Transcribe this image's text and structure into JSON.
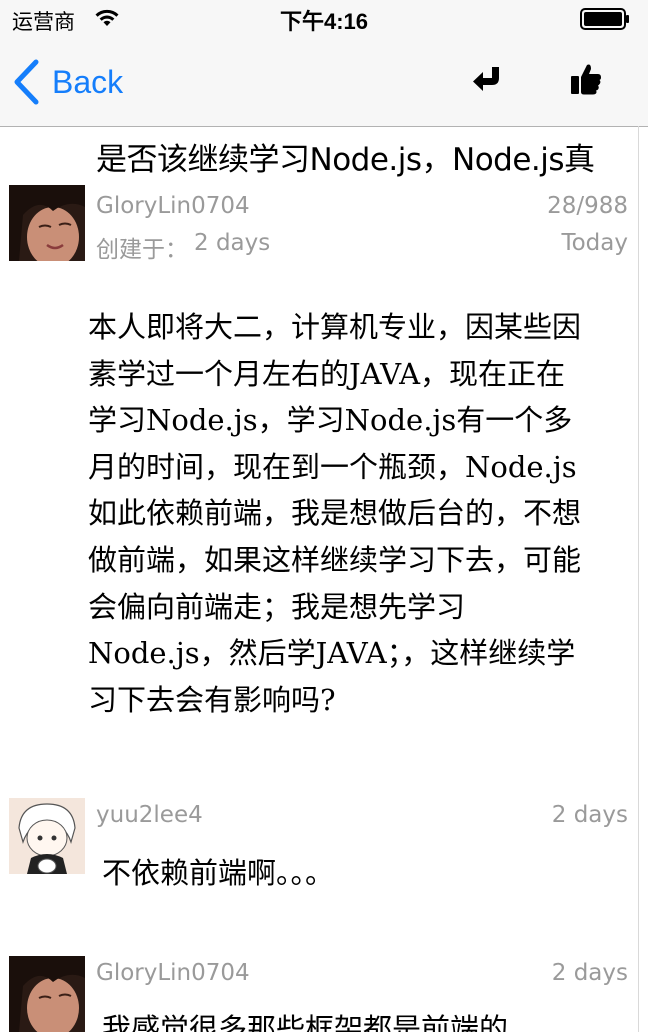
{
  "status_bar": {
    "carrier": "运营商",
    "time": "下午4:16"
  },
  "nav": {
    "back_label": "Back",
    "actions": [
      "reply-icon",
      "thumbs-up-icon"
    ]
  },
  "topic": {
    "title": "是否该继续学习Node.js，Node.js真",
    "author": "GloryLin0704",
    "counts": "28/988",
    "created_label": "创建于：",
    "created_value": "2 days",
    "updated": "Today",
    "body": "本人即将大二，计算机专业，因某些因素学过一个月左右的JAVA，现在正在学习Node.js，学习Node.js有一个多月的时间，现在到一个瓶颈，Node.js如此依赖前端，我是想做后台的，不想做前端，如果这样继续学习下去，可能会偏向前端走；我是想先学习Node.js，然后学JAVA；，这样继续学习下去会有影响吗?"
  },
  "replies": [
    {
      "author": "yuu2lee4",
      "time": "2 days",
      "content": "不依赖前端啊。。。"
    },
    {
      "author": "GloryLin0704",
      "time": "2 days",
      "content": "我感觉很多那些框架都是前端的"
    }
  ],
  "colors": {
    "accent": "#157efb",
    "meta_gray": "#9a9a9a",
    "bar_bg": "#f7f7f7"
  }
}
